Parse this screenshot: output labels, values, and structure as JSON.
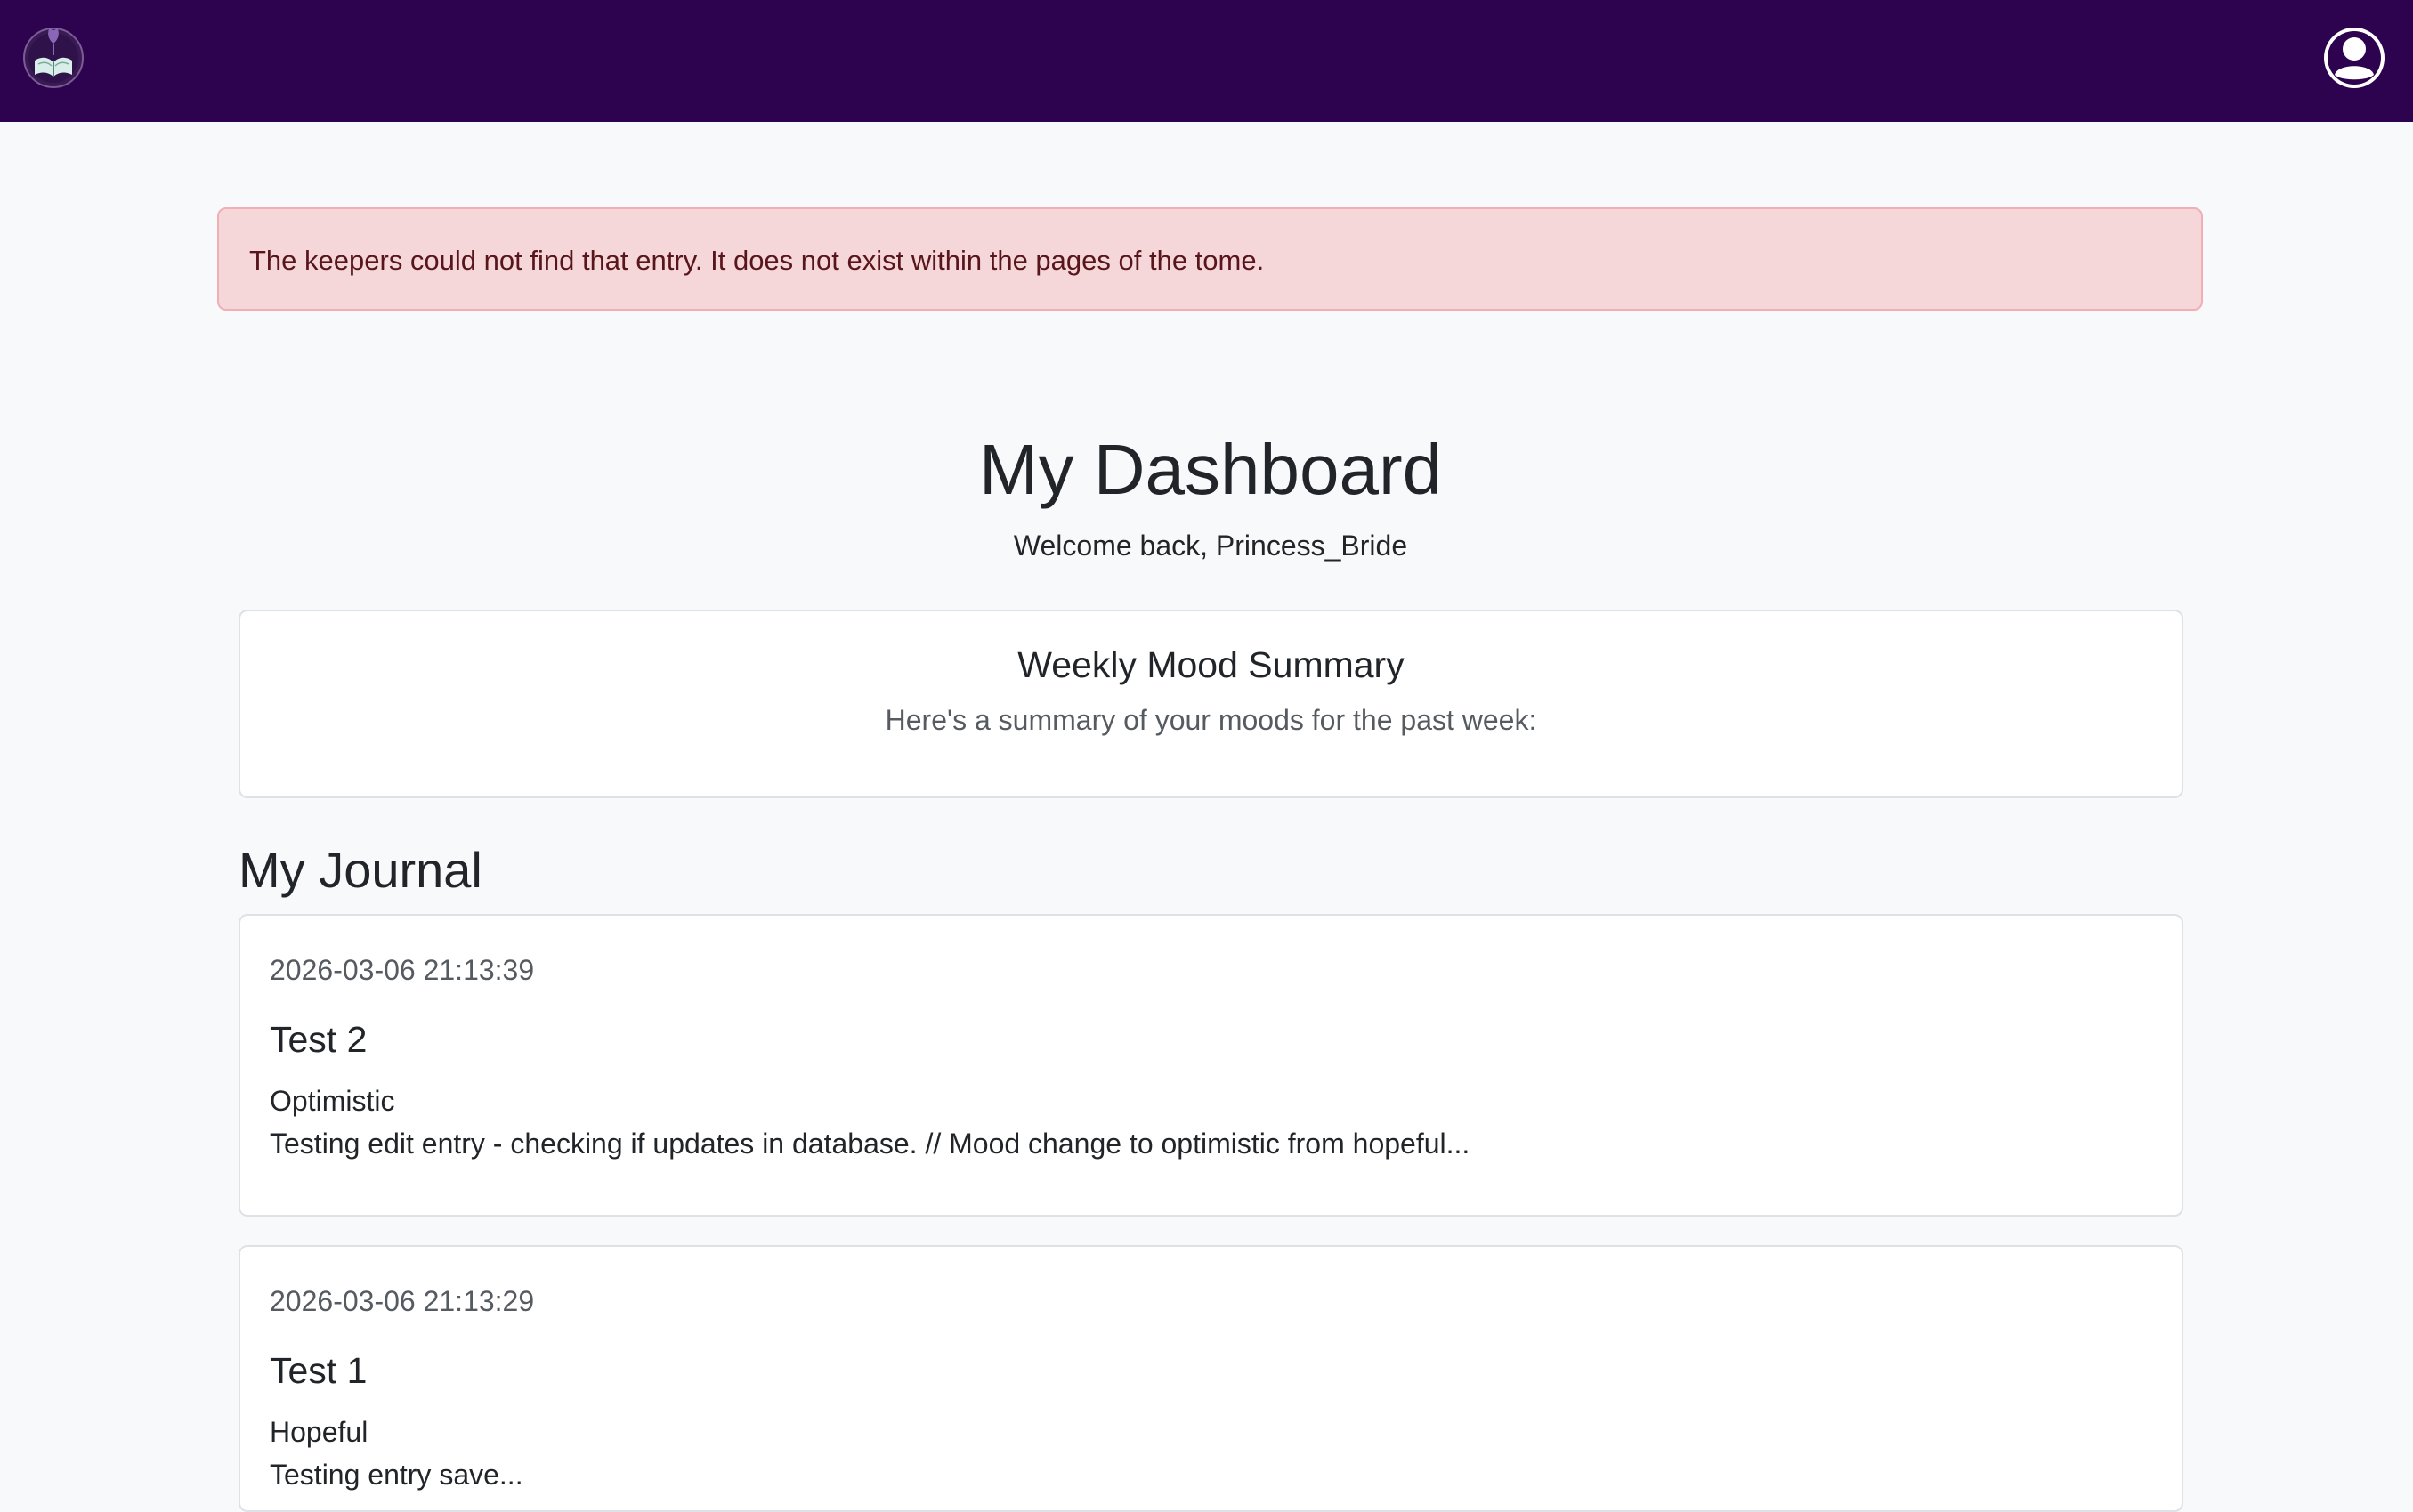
{
  "header": {
    "logo_icon": "book-lotus-logo",
    "profile_icon": "user-avatar-icon",
    "background_color": "#2d0350"
  },
  "alert": {
    "message": "The keepers could not find that entry. It does not exist within the pages of the tome.",
    "type": "danger"
  },
  "dashboard": {
    "title": "My Dashboard",
    "welcome": "Welcome back, Princess_Bride"
  },
  "mood_summary": {
    "title": "Weekly Mood Summary",
    "subtitle": "Here's a summary of your moods for the past week:"
  },
  "journal": {
    "heading": "My Journal",
    "entries": [
      {
        "date": "2026-03-06 21:13:39",
        "title": "Test 2",
        "mood": "Optimistic",
        "excerpt": "Testing edit entry - checking if updates in database. // Mood change to optimistic from hopeful..."
      },
      {
        "date": "2026-03-06 21:13:29",
        "title": "Test 1",
        "mood": "Hopeful",
        "excerpt": "Testing entry save..."
      }
    ]
  }
}
